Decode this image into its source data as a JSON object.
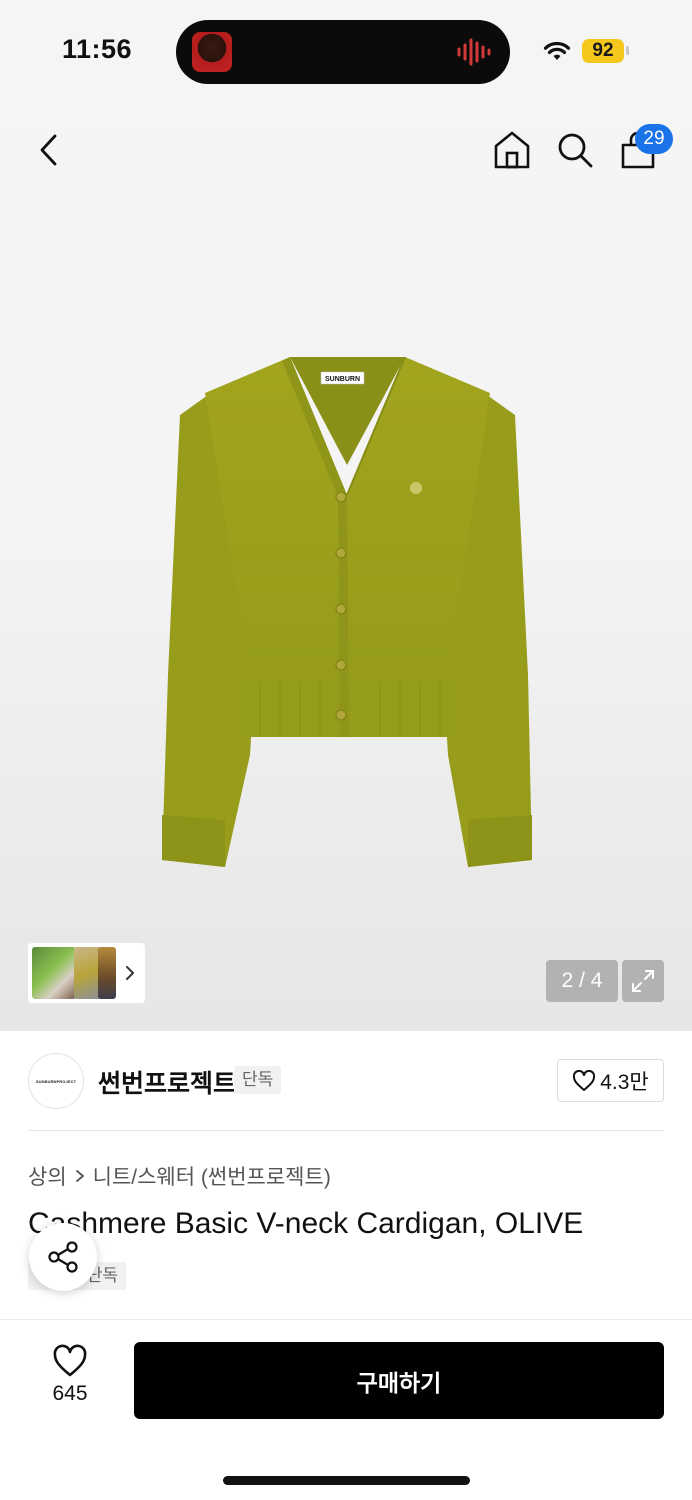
{
  "status_bar": {
    "time": "11:56",
    "battery": "92",
    "battery_color": "#f6c81c"
  },
  "nav": {
    "icons": [
      "back-icon",
      "home-icon",
      "search-icon",
      "cart-icon"
    ],
    "cart_count": "29",
    "badge_color": "#1a73e8"
  },
  "gallery": {
    "product_label": "SUNBURN",
    "page_indicator": "2 / 4",
    "garment_color": "#9aa019"
  },
  "brand": {
    "logo_text": "SUNBURNPROJECT",
    "name": "썬번프로젝트",
    "tag": "단독",
    "likes": "4.3만"
  },
  "breadcrumb": {
    "items": [
      "상의",
      "니트/스웨터 (썬번프로젝트)"
    ]
  },
  "product": {
    "title": "Cashmere Basic V-neck Cardigan, OLIVE",
    "tag": "단독"
  },
  "bottom_bar": {
    "wish_count": "645",
    "buy_label": "구매하기"
  }
}
